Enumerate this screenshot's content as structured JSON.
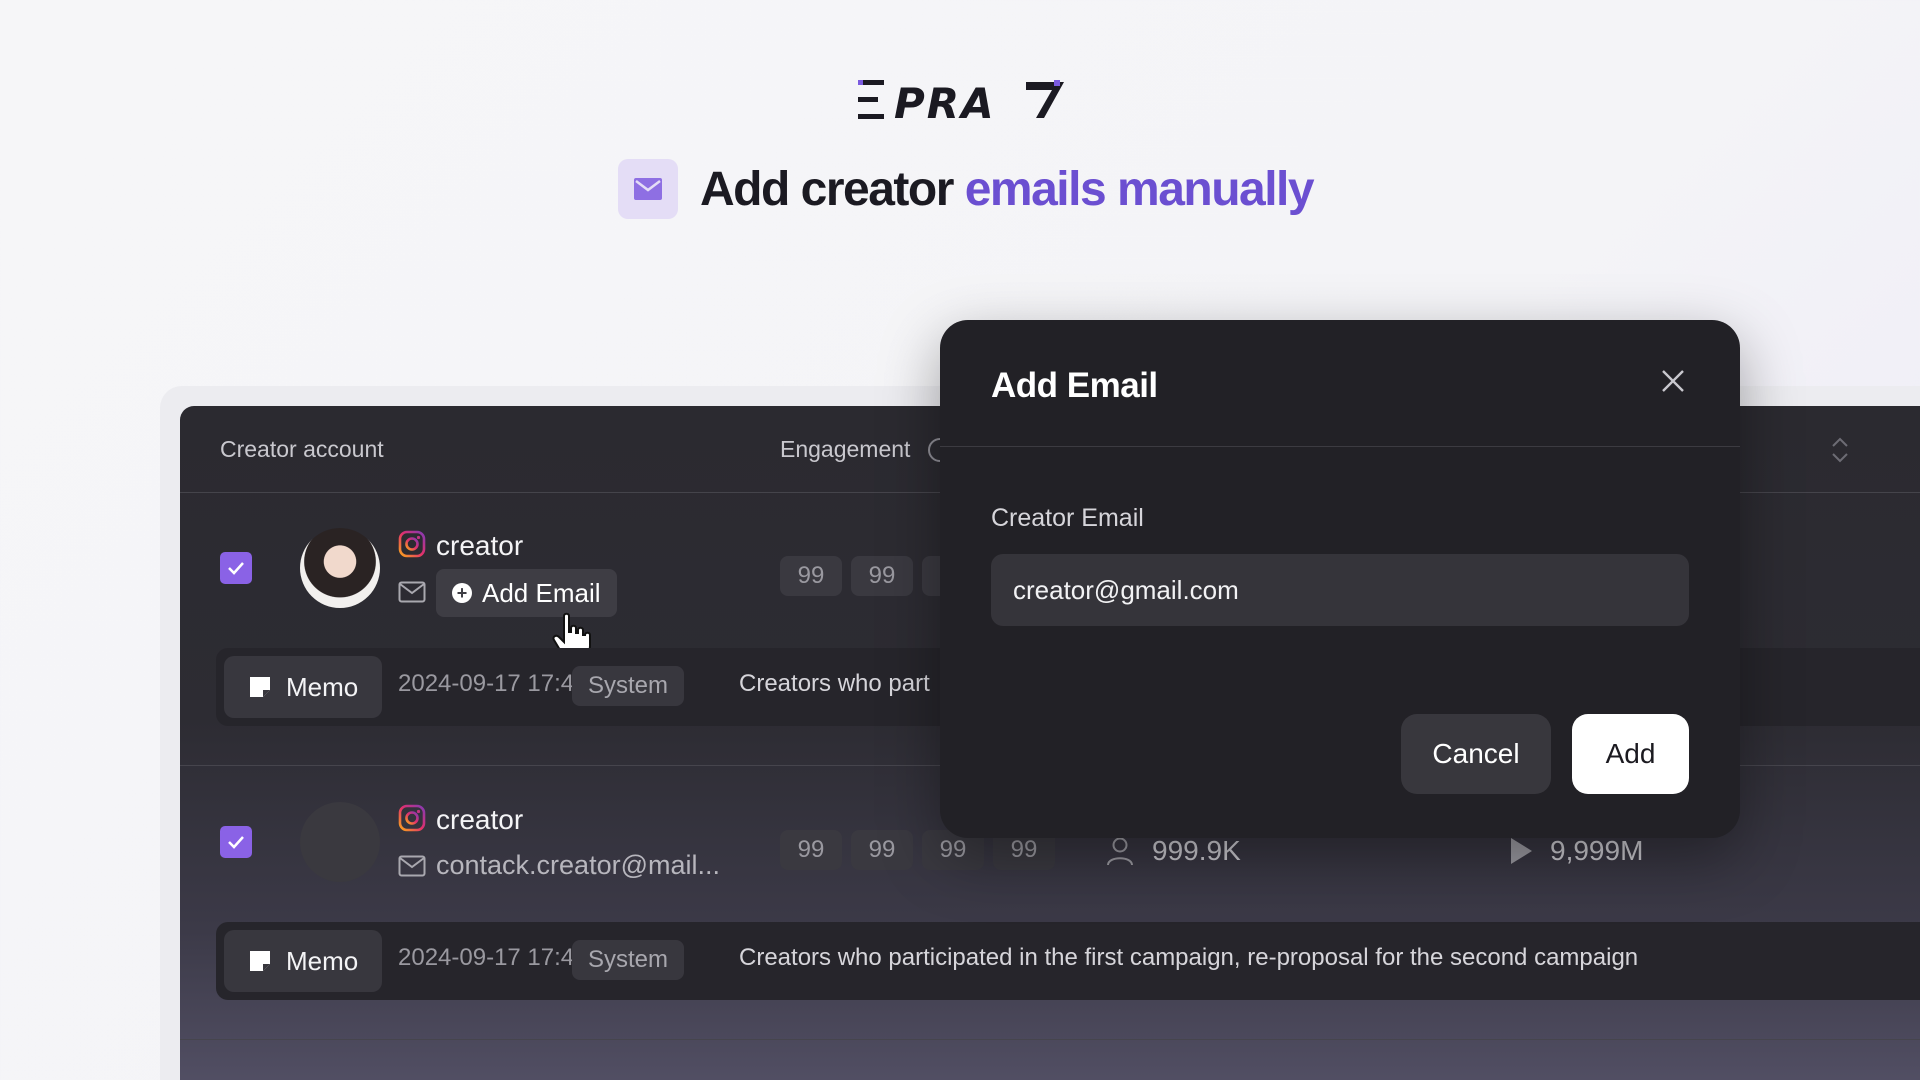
{
  "brand": {
    "logo_text": "EPRAY"
  },
  "headline": {
    "part1": "Add creator",
    "part2": "emails manually"
  },
  "table": {
    "headers": {
      "creator_account": "Creator account",
      "engagement": "Engagement"
    },
    "rows": [
      {
        "platform_icon": "instagram-icon",
        "name": "creator",
        "add_email_label": "Add Email",
        "chips": [
          "99",
          "99"
        ],
        "memo": {
          "label": "Memo",
          "date": "2024-09-17 17:46",
          "tag": "System",
          "text": "Creators who part"
        }
      },
      {
        "platform_icon": "instagram-icon",
        "name": "creator",
        "email": "contack.creator@mail...",
        "chips": [
          "99",
          "99",
          "99",
          "99"
        ],
        "followers": "999.9K",
        "views": "9,999M",
        "memo": {
          "label": "Memo",
          "date": "2024-09-17 17:46",
          "tag": "System",
          "text": "Creators who participated in the first campaign, re-proposal for the second campaign"
        }
      }
    ]
  },
  "modal": {
    "title": "Add Email",
    "field_label": "Creator Email",
    "field_value": "creator@gmail.com",
    "cancel_label": "Cancel",
    "add_label": "Add"
  },
  "colors": {
    "accent": "#6b4fd1",
    "checkbox": "#8a62e6",
    "panel": "#2b2a30",
    "modal": "#222126"
  }
}
